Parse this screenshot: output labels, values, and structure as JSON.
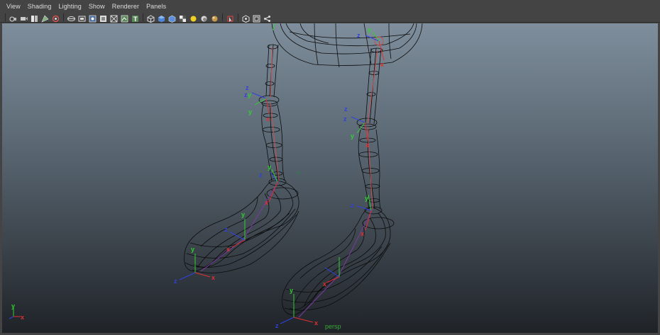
{
  "menu": {
    "items": [
      "View",
      "Shading",
      "Lighting",
      "Show",
      "Renderer",
      "Panels"
    ]
  },
  "toolbar": {
    "groups": [
      [
        "select-camera-icon",
        "camera-attributes-icon",
        "bookmarks-icon",
        "image-plane-icon",
        "grease-pencil-icon"
      ],
      [
        "grid-icon",
        "film-gate-icon",
        "resolution-gate-icon",
        "gate-mask-icon",
        "field-chart-icon",
        "safe-action-icon",
        "safe-title-icon"
      ],
      [
        "wireframe-icon",
        "smooth-shade-icon",
        "flat-shade-icon",
        "textured-icon",
        "use-lights-icon",
        "shadows-icon",
        "xray-icon"
      ],
      [
        "isolate-select-icon"
      ],
      [
        "xray-joints-icon",
        "panel-layout-icon",
        "share-icon"
      ]
    ]
  },
  "viewport": {
    "camera_label": "persp",
    "axis_labels": {
      "x": "x",
      "y": "y",
      "z": "z"
    },
    "colors": {
      "wire": "#0a0a0a",
      "bone": "#c85050",
      "axis_x": "#e03030",
      "axis_y": "#30d030",
      "axis_z": "#3040e0",
      "camera_label": "#38a838"
    }
  }
}
